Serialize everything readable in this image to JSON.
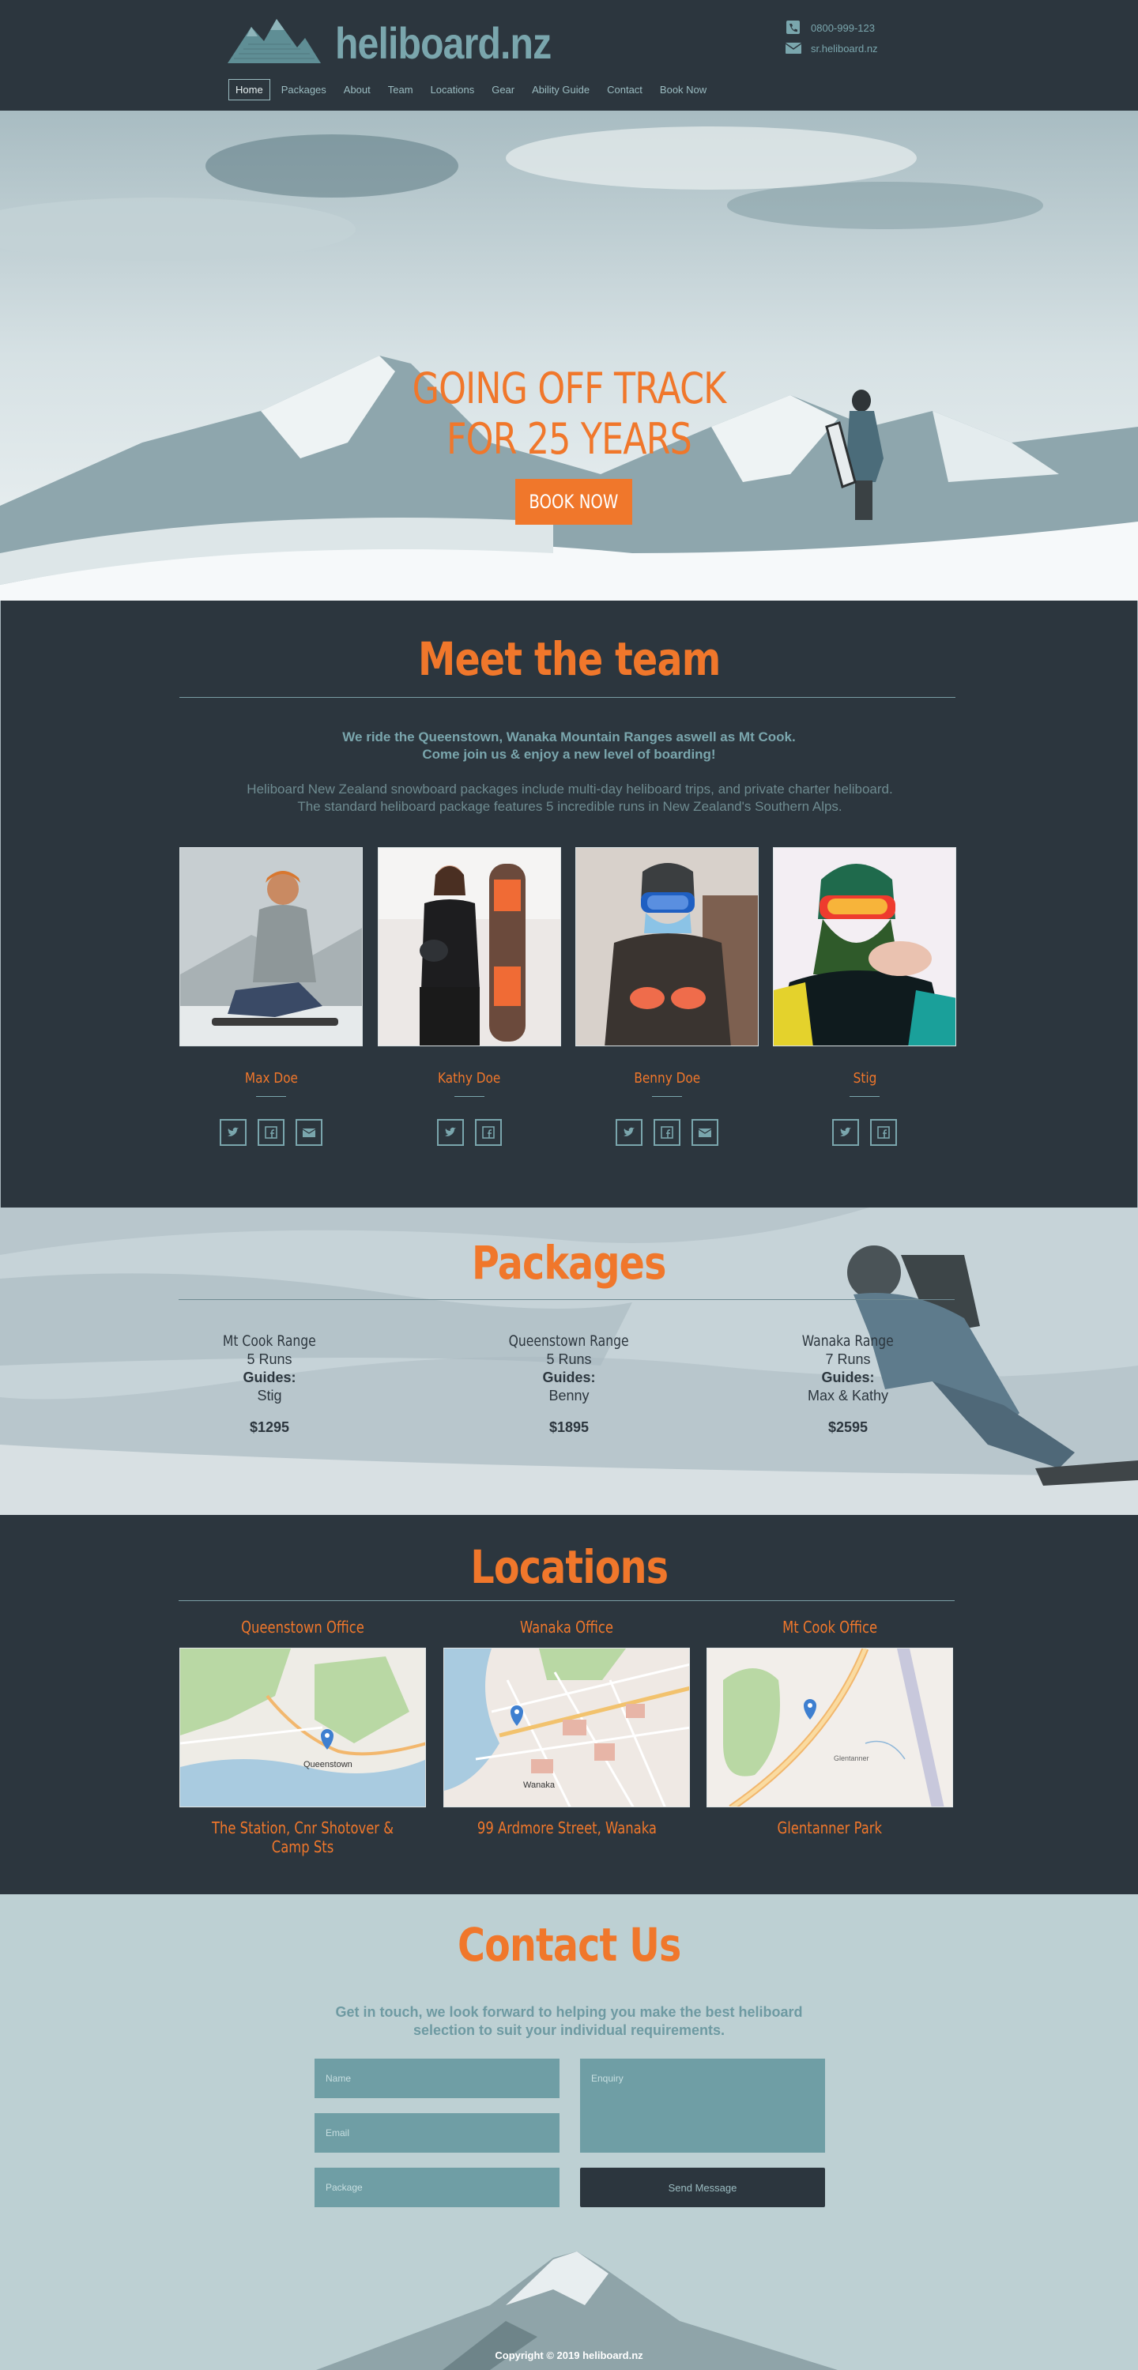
{
  "header": {
    "site_name": "heliboard.nz",
    "phone": "0800-999-123",
    "website": "sr.heliboard.nz",
    "nav": [
      "Home",
      "Packages",
      "About",
      "Team",
      "Locations",
      "Gear",
      "Ability Guide",
      "Contact",
      "Book Now"
    ]
  },
  "hero": {
    "title_line1": "GOING OFF TRACK",
    "title_line2": "FOR 25 YEARS",
    "cta": "BOOK NOW"
  },
  "team": {
    "title": "Meet the team",
    "lead_line1": "We ride the Queenstown, Wanaka Mountain Ranges aswell as Mt Cook.",
    "lead_line2": "Come join us & enjoy a new level of boarding!",
    "body": "Heliboard New Zealand snowboard packages include multi-day heliboard trips, and private charter heliboard. The standard heliboard package features 5 incredible runs in New Zealand's Southern Alps.",
    "members": [
      {
        "name": "Max Doe",
        "socials": [
          "twitter-icon",
          "facebook-icon",
          "email-icon"
        ]
      },
      {
        "name": "Kathy Doe",
        "socials": [
          "twitter-icon",
          "facebook-icon"
        ]
      },
      {
        "name": "Benny Doe",
        "socials": [
          "twitter-icon",
          "facebook-icon",
          "email-icon"
        ]
      },
      {
        "name": "Stig",
        "socials": [
          "twitter-icon",
          "facebook-icon"
        ]
      }
    ]
  },
  "packages": {
    "title": "Packages",
    "items": [
      {
        "name": "Mt Cook Range",
        "runs": "5 Runs",
        "guides_label": "Guides:",
        "guides": "Stig",
        "price": "$1295"
      },
      {
        "name": "Queenstown Range",
        "runs": "5 Runs",
        "guides_label": "Guides:",
        "guides": "Benny",
        "price": "$1895"
      },
      {
        "name": "Wanaka Range",
        "runs": "7 Runs",
        "guides_label": "Guides:",
        "guides": "Max & Kathy",
        "price": "$2595"
      }
    ]
  },
  "locations": {
    "title": "Locations",
    "offices": [
      {
        "title": "Queenstown Office",
        "address": "The Station, Cnr Shotover & Camp Sts",
        "map_label": "Queenstown"
      },
      {
        "title": "Wanaka Office",
        "address": "99 Ardmore Street, Wanaka",
        "map_label": "Wanaka"
      },
      {
        "title": "Mt Cook Office",
        "address": "Glentanner Park",
        "map_label": "Glentanner"
      }
    ]
  },
  "contact": {
    "title": "Contact Us",
    "lead_line1": "Get in touch, we look forward to helping you make the best heliboard",
    "lead_line2": "selection to suit your individual requirements.",
    "name_placeholder": "Name",
    "email_placeholder": "Email",
    "package_placeholder": "Package",
    "enquiry_placeholder": "Enquiry",
    "send_label": "Send Message",
    "copyright": "Copyright © 2019 heliboard.nz"
  },
  "colors": {
    "accent": "#f0772b",
    "dark": "#2c363e",
    "teal": "#7aa6ad"
  }
}
